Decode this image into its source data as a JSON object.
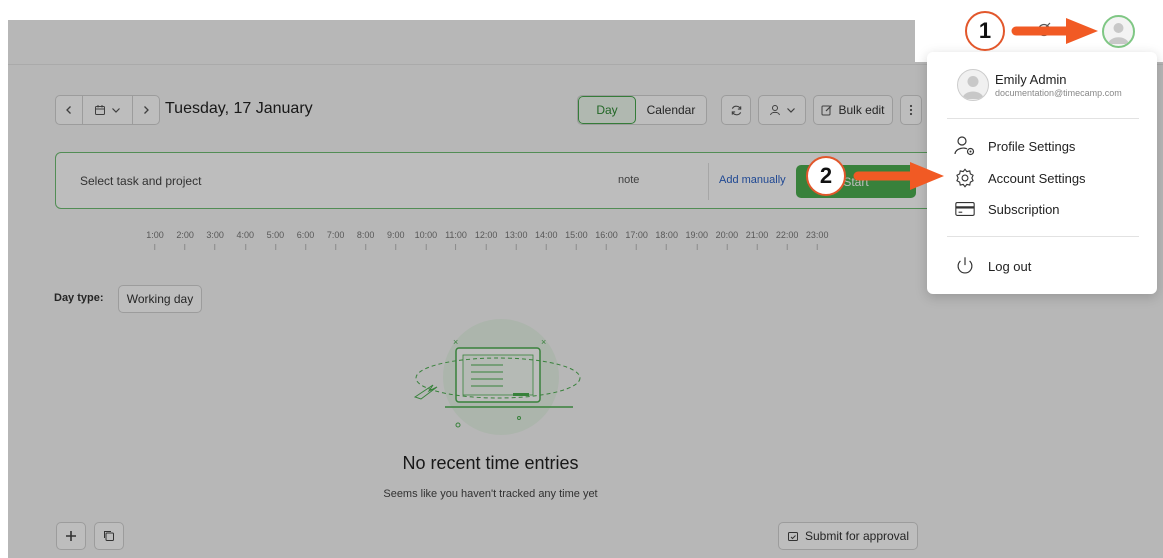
{
  "toolbar": {
    "date": "Tuesday, 17 January",
    "view_day": "Day",
    "view_calendar": "Calendar",
    "bulk_edit": "Bulk edit"
  },
  "entry": {
    "task_placeholder": "Select task and project",
    "note_placeholder": "note",
    "add_manually": "Add manually",
    "start_button": "Start"
  },
  "timeline": {
    "hours": [
      "1:00",
      "2:00",
      "3:00",
      "4:00",
      "5:00",
      "6:00",
      "7:00",
      "8:00",
      "9:00",
      "10:00",
      "11:00",
      "12:00",
      "13:00",
      "14:00",
      "15:00",
      "16:00",
      "17:00",
      "18:00",
      "19:00",
      "20:00",
      "21:00",
      "22:00",
      "23:00"
    ]
  },
  "day_type": {
    "label": "Day type:",
    "value": "Working day"
  },
  "empty_state": {
    "title": "No recent time entries",
    "subtitle": "Seems like you haven't tracked any time yet"
  },
  "footer": {
    "submit_for_approval": "Submit for approval"
  },
  "user_menu": {
    "name": "Emily Admin",
    "email": "documentation@timecamp.com",
    "items": [
      {
        "label": "Profile Settings",
        "icon": "user-gear-icon"
      },
      {
        "label": "Account Settings",
        "icon": "gear-icon"
      },
      {
        "label": "Subscription",
        "icon": "credit-card-icon"
      }
    ],
    "logout": "Log out"
  },
  "annotations": {
    "step1": "1",
    "step2": "2",
    "arrow_color": "#f15a24"
  },
  "colors": {
    "accent_green": "#4caf50",
    "link_blue": "#2b62c7"
  }
}
